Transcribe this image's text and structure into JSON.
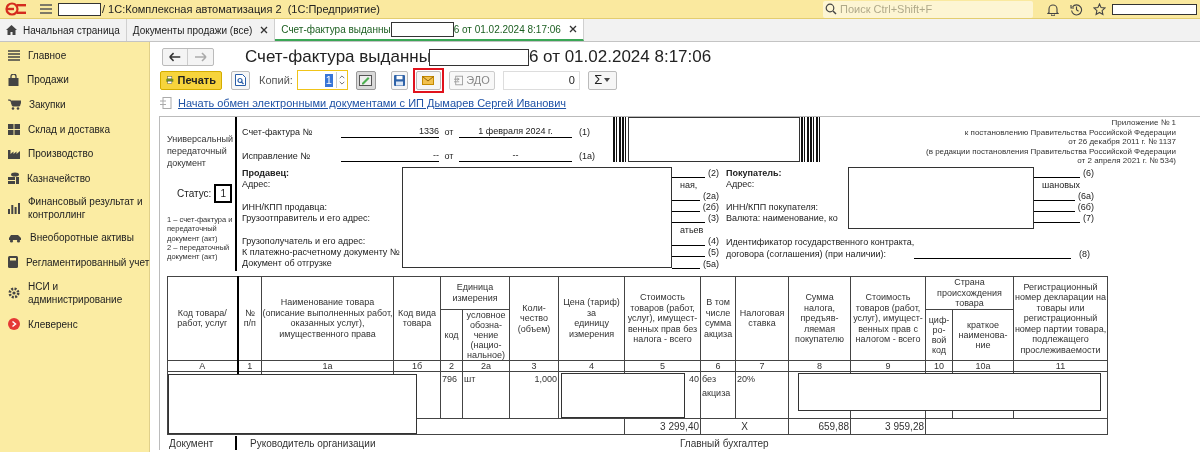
{
  "app": {
    "title": "/ 1С:Комплексная автоматизация 2  (1С:Предприятие)",
    "search_placeholder": "Поиск Ctrl+Shift+F"
  },
  "tabs": [
    {
      "label": "Начальная страница",
      "kind": "home",
      "selected": false,
      "closable": false
    },
    {
      "label": "Документы продажи (все)",
      "kind": "document",
      "selected": false,
      "closable": true
    },
    {
      "label": "Счет-фактура выданны",
      "label_end": "6 от 01.02.2024 8:17:06",
      "kind": "document",
      "selected": true,
      "closable": true
    }
  ],
  "sidebar": [
    {
      "label": "Главное"
    },
    {
      "label": "Продажи"
    },
    {
      "label": "Закупки"
    },
    {
      "label": "Склад и доставка"
    },
    {
      "label": "Производство"
    },
    {
      "label": "Казначейство"
    },
    {
      "label": "Финансовый результат и\nконтроллинг"
    },
    {
      "label": "Внеоборотные активы"
    },
    {
      "label": "Регламентированный учет"
    },
    {
      "label": "НСИ и\nадминистрирование"
    },
    {
      "label": "Клеверенс"
    }
  ],
  "form": {
    "title": "Счет-фактура выданны",
    "title_end": "6 от 01.02.2024 8:17:06",
    "print_button": "Печать",
    "copies_label": "Копий:",
    "copies_value": "1",
    "edo_button": "ЭДО",
    "counter_value": "0",
    "sum_button": "Σ",
    "exchange_link": "Начать обмен электронными документами с ИП Дымарев Сергей Иванович"
  },
  "document": {
    "type_title": "Универсальный передаточный документ",
    "status_label": "Статус:",
    "status_value": "1",
    "status_notes": [
      "1 – счет-фактура и передаточный документ (акт)",
      "2 – передаточный документ (акт)"
    ],
    "invoice_rows": [
      {
        "label": "Счет-фактура №",
        "number": "1336",
        "from": "от",
        "date": "1 февраля 2024 г.",
        "ref": "(1)"
      },
      {
        "label": "Исправление №",
        "number": "--",
        "from": "от",
        "date": "--",
        "ref": "(1а)"
      }
    ],
    "appendix": [
      "Приложение № 1",
      "к постановлению Правительства Российской Федерации",
      "от 26 декабря 2011 г. № 1137",
      "(в редакции постановления Правительства Российской Федерации",
      "от 2 апреля 2021 г. № 534)"
    ],
    "seller": {
      "label_groups": [
        [
          "Продавец:",
          "Адрес:"
        ],
        [
          "ИНН/КПП продавца:",
          "Грузоотправитель и его адрес:"
        ],
        [
          "Грузополучатель и его адрес:",
          "К платежно-расчетному документу №",
          "Документ об отгрузке"
        ]
      ],
      "side": [
        {
          "text": "(2)",
          "kind": "ref"
        },
        {
          "text": "ная,",
          "kind": "fragment"
        },
        {
          "text": "(2а)",
          "kind": "ref"
        },
        {
          "text": "(2б)",
          "kind": "ref"
        },
        {
          "text": "(3)",
          "kind": "ref"
        },
        {
          "text": "атьев",
          "kind": "fragment"
        },
        {
          "text": "(4)",
          "kind": "ref"
        },
        {
          "text": "(5)",
          "kind": "ref"
        },
        {
          "text": "(5а)",
          "kind": "ref"
        }
      ]
    },
    "buyer": {
      "label_groups": [
        [
          "Покупатель:",
          "Адрес:"
        ],
        [
          "ИНН/КПП покупателя:",
          "Валюта: наименование, ко"
        ]
      ],
      "side": [
        {
          "text": "(6)",
          "kind": "ref"
        },
        {
          "text": "шановых",
          "kind": "fragment"
        },
        {
          "text": "(6а)",
          "kind": "ref"
        },
        {
          "text": "(6б)",
          "kind": "ref"
        },
        {
          "text": "(7)",
          "kind": "ref"
        }
      ],
      "contract_lines": [
        "Идентификатор государственного контракта,",
        "договора (соглашения) (при наличии):"
      ],
      "contract_ref": "(8)"
    },
    "table": {
      "columns": [
        {
          "header": "Код товара/\nработ, услуг",
          "number": "А"
        },
        {
          "header": "№\nп/п",
          "number": "1"
        },
        {
          "header": "Наименование товара\n(описание выполненных работ,\nоказанных услуг),\nимущественного права",
          "number": "1а"
        },
        {
          "header": "Код вида\nтовара",
          "number": "1б"
        },
        {
          "header": "Единица\nизмерения",
          "children": [
            {
              "header": "код",
              "number": "2"
            },
            {
              "header": "условное\nобозна-\nчение\n(нацио-\nнальное)",
              "number": "2а"
            }
          ]
        },
        {
          "header": "Коли-\nчество\n(объем)",
          "number": "3"
        },
        {
          "header": "Цена (тариф)\nза\nединицу\nизмерения",
          "number": "4"
        },
        {
          "header": "Стоимость\nтоваров (работ,\nуслуг), имущест-\nвенных прав без\nналога - всего",
          "number": "5"
        },
        {
          "header": "В том\nчисле\nсумма\nакциза",
          "number": "6"
        },
        {
          "header": "Налоговая\nставка",
          "number": "7"
        },
        {
          "header": "Сумма\nналога,\nпредъяв-\nляемая\nпокупателю",
          "number": "8"
        },
        {
          "header": "Стоимость\nтоваров (работ,\nуслуг), имущест-\nвенных прав с\nналогом - всего",
          "number": "9"
        },
        {
          "header": "Страна\nпроисхождения\nтовара",
          "children": [
            {
              "header": "циф-\nро-\nвой\nкод",
              "number": "10"
            },
            {
              "header": "краткое\nнаименова-\nние",
              "number": "10а"
            }
          ]
        },
        {
          "header": "Регистрационный\nномер декларации на\nтовары или\nрегистрационный\nномер партии товара,\nподлежащего\nпрослеживаемости",
          "number": "11"
        }
      ],
      "row": {
        "unit_code": "796",
        "unit_name": "шт",
        "quantity": "1,000",
        "cost_fragment": "40",
        "excise": "без\nакциза",
        "tax_rate": "20%"
      },
      "total": {
        "cost": "3 299,40",
        "excise_mark": "X",
        "tax_amount": "659,88",
        "total_cost": "3 959,28"
      }
    },
    "footer": {
      "left": "Документ",
      "head": "Руководитель организации",
      "accountant": "Главный бухгалтер"
    }
  }
}
